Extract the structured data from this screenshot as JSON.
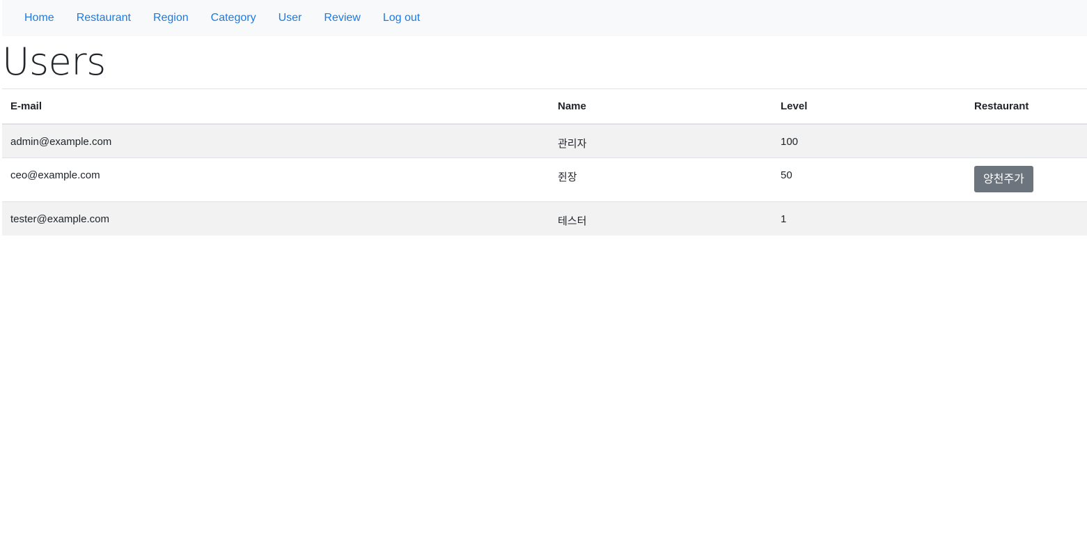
{
  "nav": {
    "items": [
      {
        "label": "Home"
      },
      {
        "label": "Restaurant"
      },
      {
        "label": "Region"
      },
      {
        "label": "Category"
      },
      {
        "label": "User"
      },
      {
        "label": "Review"
      },
      {
        "label": "Log out"
      }
    ]
  },
  "page": {
    "title": "Users"
  },
  "table": {
    "headers": {
      "email": "E-mail",
      "name": "Name",
      "level": "Level",
      "restaurant": "Restaurant"
    },
    "rows": [
      {
        "email": "admin@example.com",
        "name": "관리자",
        "level": "100",
        "restaurant": ""
      },
      {
        "email": "ceo@example.com",
        "name": "쥔장",
        "level": "50",
        "restaurant": "양천주가"
      },
      {
        "email": "tester@example.com",
        "name": "테스터",
        "level": "1",
        "restaurant": ""
      }
    ]
  },
  "colors": {
    "link": "#1f7ae0",
    "navbar_bg": "#f8f9fa",
    "stripe_bg": "#f2f2f2",
    "button_bg": "#6c757d"
  }
}
